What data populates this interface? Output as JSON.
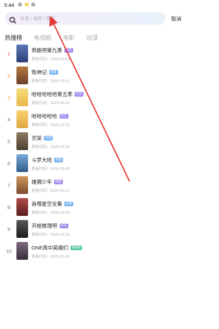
{
  "status_bar": {
    "time": "5:44",
    "icons": [
      "G",
      "M",
      "G"
    ]
  },
  "search": {
    "placeholder": "片名 / 演员 / 导演",
    "cancel_label": "取消"
  },
  "tabs": [
    {
      "label": "热搜榜"
    },
    {
      "label": "电视剧"
    },
    {
      "label": "电影"
    },
    {
      "label": "动漫"
    }
  ],
  "list": [
    {
      "rank": "1",
      "title": "奔跑吧第九季",
      "badge": "综艺",
      "updated": "更新时间：2025-06-03",
      "poster_color": "#2c3f75"
    },
    {
      "rank": "2",
      "title": "牧神记",
      "badge": "动漫",
      "updated": "更新时间：2025-06-01",
      "poster_color": "#6a3f2f"
    },
    {
      "rank": "3",
      "title": "哈哈哈哈哈第五季",
      "badge": "综艺",
      "updated": "更新时间：2025-06-03",
      "poster_color": "#f1c85a"
    },
    {
      "rank": "4",
      "title": "哈哈哈哈哈",
      "badge": "综艺",
      "updated": "更新时间：2024-03-15",
      "poster_color": "#f5c35a"
    },
    {
      "rank": "5",
      "title": "灵笼",
      "badge": "动漫",
      "updated": "更新时间：2025-05-23",
      "poster_color": "#5a4a3a"
    },
    {
      "rank": "6",
      "title": "斗罗大陆",
      "badge": "动漫",
      "updated": "更新时间：2024-06-03",
      "poster_color": "#3a6a95"
    },
    {
      "rank": "7",
      "title": "雄狮少年",
      "badge": "电影",
      "updated": "更新时间：2025-06-01",
      "poster_color": "#8a5a3a"
    },
    {
      "rank": "8",
      "title": "吞噬星空全集",
      "badge": "动漫",
      "updated": "更新时间：2025-06-02",
      "poster_color": "#7a2e2e"
    },
    {
      "rank": "9",
      "title": "开始推理吧",
      "badge": "综艺",
      "updated": "更新时间：2025-04-23",
      "poster_color": "#2a2a2a"
    },
    {
      "rank": "10",
      "title": "ONE高中英雄们",
      "badge": "电视剧",
      "updated": "更新时间：2025-05-30",
      "poster_color": "#4a4050"
    }
  ]
}
